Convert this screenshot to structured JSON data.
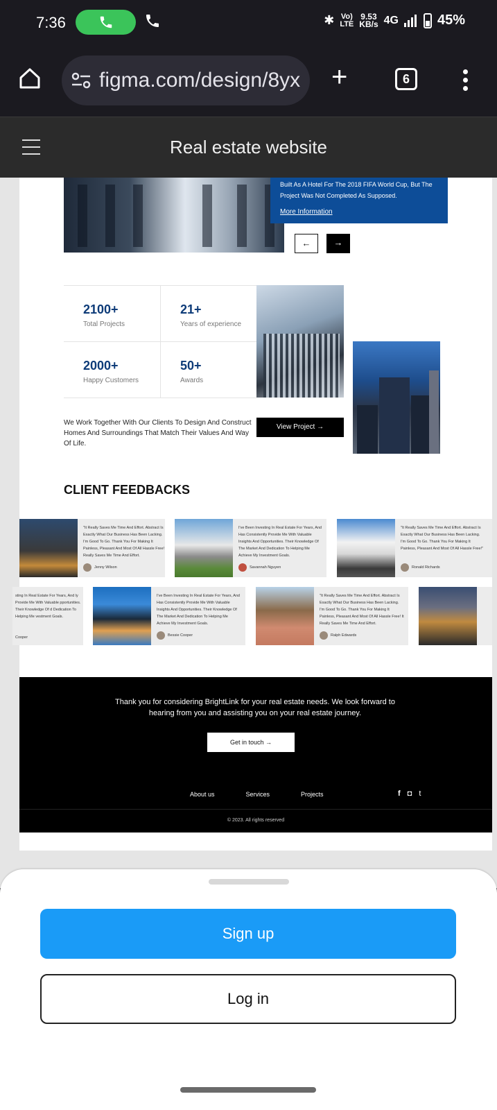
{
  "status_bar": {
    "time": "7:36",
    "network_rate_value": "9.53",
    "network_rate_unit": "KB/s",
    "volte_top": "Vo)",
    "volte_bottom": "LTE",
    "network_type": "4G",
    "battery": "45%"
  },
  "browser": {
    "url": "figma.com/design/8yx",
    "tab_count": "6"
  },
  "figma": {
    "title": "Real estate website"
  },
  "hero": {
    "card_line1": "Built As A Hotel For The 2018 FIFA World Cup, But The",
    "card_line2": "Project Was Not Completed As Supposed.",
    "more_link": "More Information",
    "prev_arrow": "←",
    "next_arrow": "→"
  },
  "stats": [
    {
      "value": "2100+",
      "label": "Total Projects"
    },
    {
      "value": "21+",
      "label": "Years of experience"
    },
    {
      "value": "2000+",
      "label": "Happy Customers"
    },
    {
      "value": "50+",
      "label": "Awards"
    }
  ],
  "mission": {
    "text": "We Work Together With Our Clients To Design And Construct Homes And Surroundings That Match Their Values And Way Of Life.",
    "view_button": "View Project →"
  },
  "feedbacks": {
    "title": "CLIENT FEEDBACKS",
    "row1": [
      {
        "text": "\"It Really Saves Me Time And Effort. Abstract Is Exactly What Our Business Has Been Lacking. I'm Good To Go. Thank You For Making It Painless, Pleasant And Most Of All Hassle Free! It Really Saves Me Time And Effort.",
        "name": "Jenny Wilson"
      },
      {
        "text": "I've Been Investing In Real Estate For Years, And Has Consistently Provide Me With Valuable Insights And Opportunities. Their Knowledge Of The Market And Dedication To Helping Me Achieve My Investment Goals.",
        "name": "Savannah Nguyen"
      },
      {
        "text": "\"It Really Saves Me Time And Effort. Abstract Is Exactly What Our Business Has Been Lacking. I'm Good To Go. Thank You For Making It Painless, Pleasant And Most Of All Hassle Free!\"",
        "name": "Ronald Richards"
      }
    ],
    "row2": [
      {
        "text": "sting In Real Estate For Years, And ly Provide Me With Valuable pportunities. Their Knowledge Of d Dedication To Helping Me vestment Goals.",
        "name": "Cooper"
      },
      {
        "text": "I've Been Investing In Real Estate For Years, And Has Consistently Provide Me With Valuable Insights And Opportunities. Their Knowledge Of The Market And Dedication To Helping Me Achieve My Investment Goals.",
        "name": "Bessie Cooper"
      },
      {
        "text": "\"It Really Saves Me Time And Effort. Abstract Is Exactly What Our Business Has Been Lacking. I'm Good To Go. Thank You For Making It Painless, Pleasant And Most Of All Hassle Free! It Really Saves Me Time And Effort.",
        "name": "Ralph Edwards"
      }
    ]
  },
  "footer": {
    "message": "Thank you for considering BrightLink for your real estate needs. We look forward to hearing from you and assisting you on your real estate journey.",
    "cta": "Get in touch →",
    "links": [
      "About us",
      "Services",
      "Projects"
    ],
    "social": [
      "f",
      "◘",
      "t"
    ],
    "copyright": "© 2023. All rights reserved"
  },
  "sheet": {
    "signup": "Sign up",
    "login": "Log in"
  },
  "colors": {
    "accent_blue": "#1a9bf7",
    "brand_navy": "#0d4d98",
    "call_green": "#3bc45a"
  }
}
